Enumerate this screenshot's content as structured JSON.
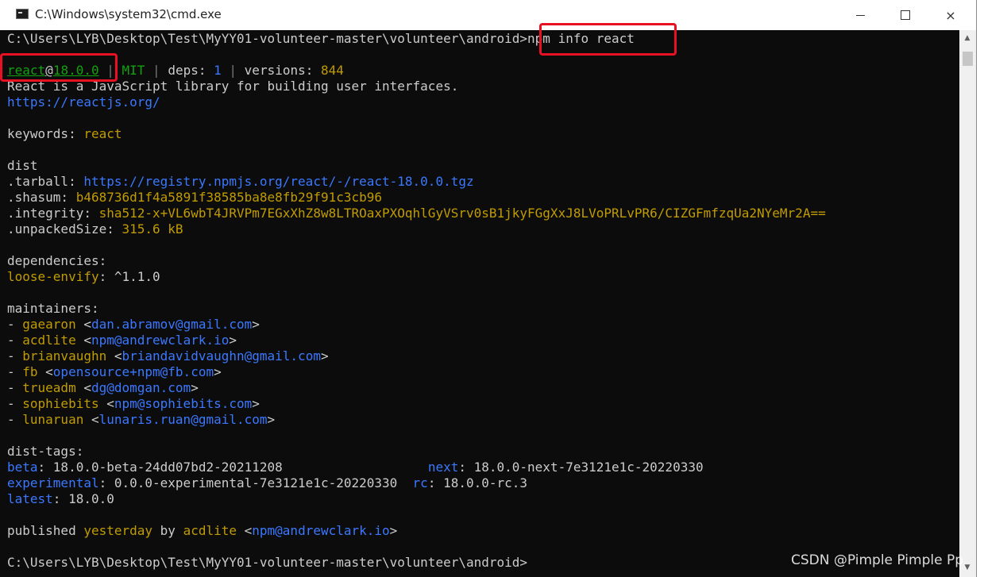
{
  "window": {
    "title": "C:\\Windows\\system32\\cmd.exe",
    "minimize_label": "—",
    "maximize_label": "□",
    "close_label": "×"
  },
  "terminal": {
    "lines": [
      {
        "segments": [
          {
            "text": "C:\\Users\\LYB\\Desktop\\Test\\MyYY01-volunteer-master\\volunteer\\android>",
            "color": "default"
          },
          {
            "text": "npm info react",
            "color": "default"
          }
        ]
      },
      {
        "segments": []
      },
      {
        "segments": [
          {
            "text": "react",
            "color": "green",
            "underline": true
          },
          {
            "text": "@",
            "color": "default",
            "underline": true
          },
          {
            "text": "18.0.0",
            "color": "green",
            "underline": true
          },
          {
            "text": " | ",
            "color": "gray"
          },
          {
            "text": "MIT",
            "color": "green"
          },
          {
            "text": " | ",
            "color": "gray"
          },
          {
            "text": "deps: ",
            "color": "default"
          },
          {
            "text": "1",
            "color": "blue"
          },
          {
            "text": " | ",
            "color": "gray"
          },
          {
            "text": "versions: ",
            "color": "default"
          },
          {
            "text": "844",
            "color": "yellow"
          }
        ]
      },
      {
        "segments": [
          {
            "text": "React is a JavaScript library for building user interfaces.",
            "color": "default"
          }
        ]
      },
      {
        "segments": [
          {
            "text": "https://reactjs.org/",
            "color": "blue"
          }
        ]
      },
      {
        "segments": []
      },
      {
        "segments": [
          {
            "text": "keywords: ",
            "color": "default"
          },
          {
            "text": "react",
            "color": "yellow"
          }
        ]
      },
      {
        "segments": []
      },
      {
        "segments": [
          {
            "text": "dist",
            "color": "default"
          }
        ]
      },
      {
        "segments": [
          {
            "text": ".tarball: ",
            "color": "default"
          },
          {
            "text": "https://registry.npmjs.org/react/-/react-18.0.0.tgz",
            "color": "blue"
          }
        ]
      },
      {
        "segments": [
          {
            "text": ".shasum: ",
            "color": "default"
          },
          {
            "text": "b468736d1f4a5891f38585ba8e8fb29f91c3cb96",
            "color": "yellow"
          }
        ]
      },
      {
        "segments": [
          {
            "text": ".integrity: ",
            "color": "default"
          },
          {
            "text": "sha512-x+VL6wbT4JRVPm7EGxXhZ8w8LTROaxPXOqhlGyVSrv0sB1jkyFGgXxJ8LVoPRLvPR6/CIZGFmfzqUa2NYeMr2A==",
            "color": "yellow"
          }
        ]
      },
      {
        "segments": [
          {
            "text": ".unpackedSize: ",
            "color": "default"
          },
          {
            "text": "315.6 kB",
            "color": "yellow"
          }
        ]
      },
      {
        "segments": []
      },
      {
        "segments": [
          {
            "text": "dependencies:",
            "color": "default"
          }
        ]
      },
      {
        "segments": [
          {
            "text": "loose-envify",
            "color": "yellow"
          },
          {
            "text": ": ^1.1.0",
            "color": "default"
          }
        ]
      },
      {
        "segments": []
      },
      {
        "segments": [
          {
            "text": "maintainers:",
            "color": "default"
          }
        ]
      },
      {
        "segments": [
          {
            "text": "- ",
            "color": "default"
          },
          {
            "text": "gaearon",
            "color": "yellow"
          },
          {
            "text": " <",
            "color": "default"
          },
          {
            "text": "dan.abramov@gmail.com",
            "color": "blue"
          },
          {
            "text": ">",
            "color": "default"
          }
        ]
      },
      {
        "segments": [
          {
            "text": "- ",
            "color": "default"
          },
          {
            "text": "acdlite",
            "color": "yellow"
          },
          {
            "text": " <",
            "color": "default"
          },
          {
            "text": "npm@andrewclark.io",
            "color": "blue"
          },
          {
            "text": ">",
            "color": "default"
          }
        ]
      },
      {
        "segments": [
          {
            "text": "- ",
            "color": "default"
          },
          {
            "text": "brianvaughn",
            "color": "yellow"
          },
          {
            "text": " <",
            "color": "default"
          },
          {
            "text": "briandavidvaughn@gmail.com",
            "color": "blue"
          },
          {
            "text": ">",
            "color": "default"
          }
        ]
      },
      {
        "segments": [
          {
            "text": "- ",
            "color": "default"
          },
          {
            "text": "fb",
            "color": "yellow"
          },
          {
            "text": " <",
            "color": "default"
          },
          {
            "text": "opensource+npm@fb.com",
            "color": "blue"
          },
          {
            "text": ">",
            "color": "default"
          }
        ]
      },
      {
        "segments": [
          {
            "text": "- ",
            "color": "default"
          },
          {
            "text": "trueadm",
            "color": "yellow"
          },
          {
            "text": " <",
            "color": "default"
          },
          {
            "text": "dg@domgan.com",
            "color": "blue"
          },
          {
            "text": ">",
            "color": "default"
          }
        ]
      },
      {
        "segments": [
          {
            "text": "- ",
            "color": "default"
          },
          {
            "text": "sophiebits",
            "color": "yellow"
          },
          {
            "text": " <",
            "color": "default"
          },
          {
            "text": "npm@sophiebits.com",
            "color": "blue"
          },
          {
            "text": ">",
            "color": "default"
          }
        ]
      },
      {
        "segments": [
          {
            "text": "- ",
            "color": "default"
          },
          {
            "text": "lunaruan",
            "color": "yellow"
          },
          {
            "text": " <",
            "color": "default"
          },
          {
            "text": "lunaris.ruan@gmail.com",
            "color": "blue"
          },
          {
            "text": ">",
            "color": "default"
          }
        ]
      },
      {
        "segments": []
      },
      {
        "segments": [
          {
            "text": "dist-tags:",
            "color": "default"
          }
        ]
      },
      {
        "segments": [
          {
            "text": "beta",
            "color": "blue"
          },
          {
            "text": ": 18.0.0-beta-24dd07bd2-20211208                   ",
            "color": "default"
          },
          {
            "text": "next",
            "color": "blue"
          },
          {
            "text": ": 18.0.0-next-7e3121e1c-20220330",
            "color": "default"
          }
        ]
      },
      {
        "segments": [
          {
            "text": "experimental",
            "color": "blue"
          },
          {
            "text": ": 0.0.0-experimental-7e3121e1c-20220330  ",
            "color": "default"
          },
          {
            "text": "rc",
            "color": "blue"
          },
          {
            "text": ": 18.0.0-rc.3",
            "color": "default"
          }
        ]
      },
      {
        "segments": [
          {
            "text": "latest",
            "color": "blue"
          },
          {
            "text": ": 18.0.0",
            "color": "default"
          }
        ]
      },
      {
        "segments": []
      },
      {
        "segments": [
          {
            "text": "published ",
            "color": "default"
          },
          {
            "text": "yesterday",
            "color": "yellow"
          },
          {
            "text": " by ",
            "color": "default"
          },
          {
            "text": "acdlite",
            "color": "yellow"
          },
          {
            "text": " <",
            "color": "default"
          },
          {
            "text": "npm@andrewclark.io",
            "color": "blue"
          },
          {
            "text": ">",
            "color": "default"
          }
        ]
      },
      {
        "segments": []
      },
      {
        "segments": [
          {
            "text": "C:\\Users\\LYB\\Desktop\\Test\\MyYY01-volunteer-master\\volunteer\\android>",
            "color": "default"
          }
        ]
      }
    ]
  },
  "scrollbar": {
    "up_arrow_icon": "chevron-up-icon",
    "down_arrow_icon": "chevron-down-icon"
  },
  "watermark": "CSDN @Pimple Pimple Pp",
  "colors": {
    "terminal_bg": "#0c0c0c",
    "default": "#cccccc",
    "green": "#13a10e",
    "yellow": "#c19c00",
    "blue": "#3b78ff",
    "gray": "#767676",
    "highlight": "#e81123"
  }
}
